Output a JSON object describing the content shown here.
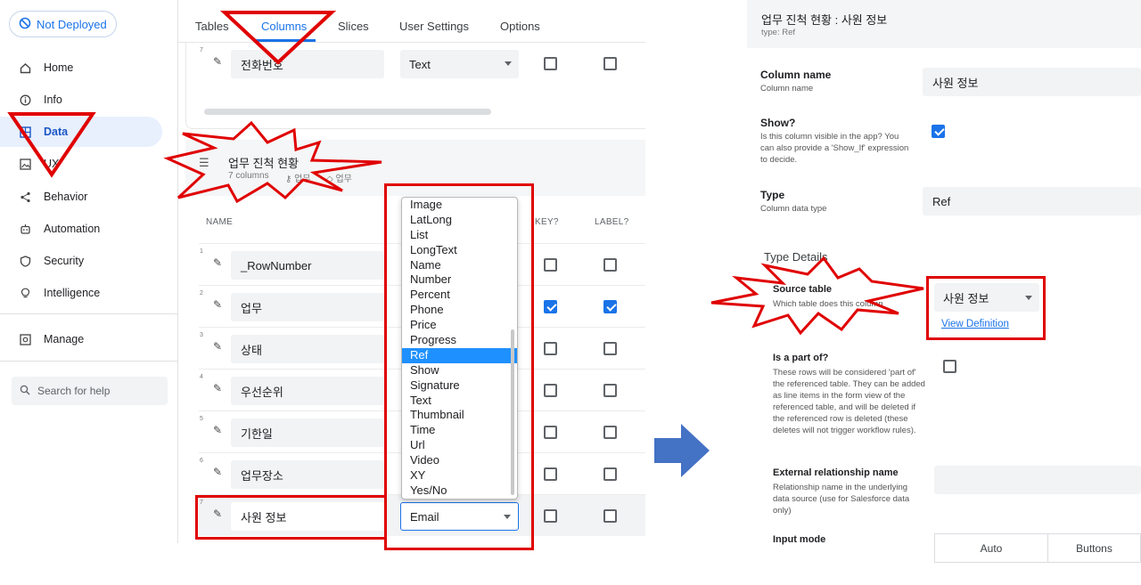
{
  "sidebar": {
    "deploy_status": "Not Deployed",
    "items": [
      {
        "label": "Home"
      },
      {
        "label": "Info"
      },
      {
        "label": "Data"
      },
      {
        "label": "UX"
      },
      {
        "label": "Behavior"
      },
      {
        "label": "Automation"
      },
      {
        "label": "Security"
      },
      {
        "label": "Intelligence"
      },
      {
        "label": "Manage"
      }
    ],
    "search_placeholder": "Search for help"
  },
  "tabs": [
    {
      "label": "Tables"
    },
    {
      "label": "Columns",
      "active": true
    },
    {
      "label": "Slices"
    },
    {
      "label": "User Settings"
    },
    {
      "label": "Options"
    }
  ],
  "prev_table_row": {
    "num": "7",
    "name": "전화번호",
    "type": "Text"
  },
  "table": {
    "title": "업무 진척 현황",
    "meta_columns": "7 columns",
    "meta_key": "업무",
    "meta_label": "업무"
  },
  "column_headers": {
    "name": "NAME",
    "key": "KEY?",
    "label": "LABEL?"
  },
  "rows": [
    {
      "num": "1",
      "name": "_RowNumber",
      "key": false,
      "label": false
    },
    {
      "num": "2",
      "name": "업무",
      "key": true,
      "label": true
    },
    {
      "num": "3",
      "name": "상태",
      "key": false,
      "label": false
    },
    {
      "num": "4",
      "name": "우선순위",
      "key": false,
      "label": false
    },
    {
      "num": "5",
      "name": "기한일",
      "key": false,
      "label": false
    },
    {
      "num": "6",
      "name": "업무장소",
      "key": false,
      "label": false
    },
    {
      "num": "7",
      "name": "사원 정보",
      "type": "Email",
      "key": false,
      "label": false
    }
  ],
  "type_dropdown": {
    "options": [
      "Image",
      "LatLong",
      "List",
      "LongText",
      "Name",
      "Number",
      "Percent",
      "Phone",
      "Price",
      "Progress",
      "Ref",
      "Show",
      "Signature",
      "Text",
      "Thumbnail",
      "Time",
      "Url",
      "Video",
      "XY",
      "Yes/No"
    ],
    "highlighted": "Ref"
  },
  "detail": {
    "title": "업무 진척 현황 : 사원 정보",
    "subtitle": "type: Ref",
    "column_name": {
      "label": "Column name",
      "help": "Column name",
      "value": "사원 정보"
    },
    "show": {
      "label": "Show?",
      "help": "Is this column visible in the app? You can also provide a 'Show_If' expression to decide.",
      "checked": true
    },
    "type": {
      "label": "Type",
      "help": "Column data type",
      "value": "Ref"
    },
    "type_details_title": "Type Details",
    "source_table": {
      "label": "Source table",
      "help": "Which table does this column reference?",
      "value": "사원 정보",
      "link": "View Definition"
    },
    "is_part_of": {
      "label": "Is a part of?",
      "help": "These rows will be considered 'part of' the referenced table. They can be added as line items in the form view of the referenced table, and will be deleted if the referenced row is deleted (these deletes will not trigger workflow rules)."
    },
    "external_relationship": {
      "label": "External relationship name",
      "help": "Relationship name in the underlying data source (use for Salesforce data only)"
    },
    "input_mode": {
      "label": "Input mode",
      "options": [
        "Auto",
        "Buttons"
      ]
    }
  },
  "colors": {
    "accent": "#1a73e8",
    "annotation": "#e00000",
    "arrow": "#4472c4"
  }
}
